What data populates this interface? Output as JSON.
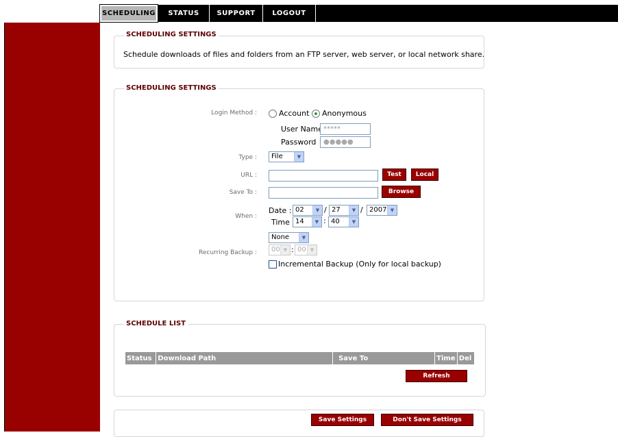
{
  "nav": {
    "tabs": [
      {
        "label": "SCHEDULING",
        "active": true
      },
      {
        "label": "STATUS",
        "active": false
      },
      {
        "label": "SUPPORT",
        "active": false
      },
      {
        "label": "LOGOUT",
        "active": false
      }
    ]
  },
  "intro_box": {
    "legend": "SCHEDULING SETTINGS",
    "description": "Schedule downloads of files and folders from an FTP server, web server, or local network share."
  },
  "settings_box": {
    "legend": "SCHEDULING SETTINGS",
    "login_method_label": "Login Method :",
    "login_options": [
      "Account",
      "Anonymous"
    ],
    "login_selected": "Anonymous",
    "user_name_label": "User Name",
    "user_name_value": "*****",
    "password_label": "Password",
    "password_value": "●●●●●",
    "type_label": "Type :",
    "type_value": "File",
    "url_label": "URL :",
    "url_value": "",
    "test_button": "Test",
    "local_button": "Local",
    "save_to_label": "Save To :",
    "save_to_value": "",
    "browse_button": "Browse",
    "when_label": "When :",
    "date_label": "Date :",
    "date_month": "02",
    "date_day": "27",
    "date_year": "2007",
    "date_sep": "/",
    "time_label": "Time :",
    "time_hour": "14",
    "time_minute": "40",
    "time_sep": ":",
    "recurring_label": "Recurring Backup :",
    "recurring_value": "None",
    "recurring_hour": "00",
    "recurring_minute": "00",
    "recurring_sep": ":",
    "incremental_label": "Incremental Backup (Only for local backup)",
    "incremental_checked": false
  },
  "schedule_list": {
    "legend": "SCHEDULE LIST",
    "columns": [
      "Status",
      "Download Path",
      "Save To",
      "Time",
      "Del"
    ],
    "refresh_button": "Refresh"
  },
  "footer": {
    "save_button": "Save Settings",
    "dont_save_button": "Don't Save Settings"
  },
  "colors": {
    "brand_red": "#990000",
    "nav_bg": "#000000",
    "legend_text": "#5c0000"
  }
}
